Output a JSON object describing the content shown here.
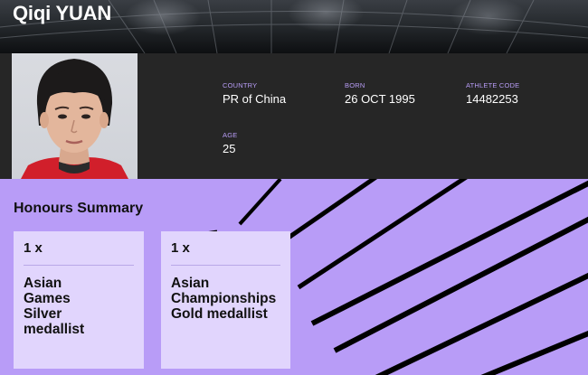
{
  "athlete": {
    "name": "Qiqi YUAN"
  },
  "profile": {
    "photo_icon": "athlete-portrait",
    "country": {
      "label": "COUNTRY",
      "value": "PR of China"
    },
    "born": {
      "label": "BORN",
      "value": "26 OCT 1995"
    },
    "athlete_code": {
      "label": "ATHLETE CODE",
      "value": "14482253"
    },
    "age": {
      "label": "AGE",
      "value": "25"
    }
  },
  "honours": {
    "title": "Honours Summary",
    "cards": [
      {
        "count": "1 x",
        "text": "Asian Games Silver medallist"
      },
      {
        "count": "1 x",
        "text": "Asian Championships Gold medallist"
      }
    ]
  },
  "colors": {
    "accent_purple": "#b89cf7",
    "card_bg": "#e1d5fd",
    "label_purple": "#b79cf5",
    "profile_bg": "#262626"
  }
}
